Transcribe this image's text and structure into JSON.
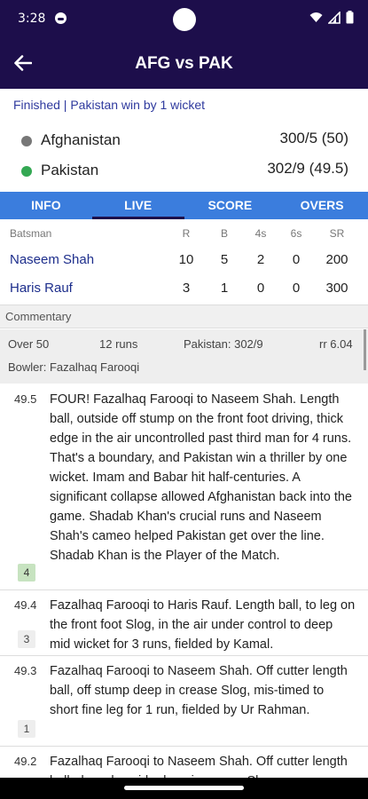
{
  "status": {
    "time": "3:28"
  },
  "header": {
    "title": "AFG vs PAK"
  },
  "result": "Finished | Pakistan win by 1 wicket",
  "teams": [
    {
      "name": "Afghanistan",
      "score": "300/5 (50)",
      "dot_color": "#777777"
    },
    {
      "name": "Pakistan",
      "score": "302/9 (49.5)",
      "dot_color": "#34a853"
    }
  ],
  "tabs": [
    {
      "label": "INFO"
    },
    {
      "label": "LIVE"
    },
    {
      "label": "SCORE"
    },
    {
      "label": "OVERS"
    }
  ],
  "batting": {
    "headers": [
      "Batsman",
      "R",
      "B",
      "4s",
      "6s",
      "SR"
    ],
    "rows": [
      {
        "name": "Naseem Shah",
        "r": "10",
        "b": "5",
        "fours": "2",
        "sixes": "0",
        "sr": "200"
      },
      {
        "name": "Haris Rauf",
        "r": "3",
        "b": "1",
        "fours": "0",
        "sixes": "0",
        "sr": "300"
      }
    ]
  },
  "commentary": {
    "label": "Commentary",
    "over": "Over 50",
    "runs": "12 runs",
    "team_score": "Pakistan: 302/9",
    "run_rate": "rr 6.04",
    "bowler": "Bowler: Fazalhaq Farooqi",
    "balls": [
      {
        "over": "49.5",
        "runs": "4",
        "text": "FOUR! Fazalhaq Farooqi to Naseem Shah. Length ball, outside off stump on the front foot driving, thick edge in the air uncontrolled past third man for 4 runs. That's a boundary, and Pakistan win a thriller by one wicket. Imam and Babar hit half-centuries. A significant collapse allowed Afghanistan back into the game. Shadab Khan's crucial runs and Naseem Shah's cameo helped Pakistan get over the line. Shadab Khan is the Player of the Match."
      },
      {
        "over": "49.4",
        "runs": "3",
        "text": "Fazalhaq Farooqi to Haris Rauf. Length ball, to leg on the front foot Slog, in the air under control to deep mid wicket for 3 runs, fielded by Kamal."
      },
      {
        "over": "49.3",
        "runs": "1",
        "text": "Fazalhaq Farooqi to Naseem Shah. Off cutter length ball, off stump deep in crease Slog, mis-timed to short fine leg for 1 run, fielded by Ur Rahman."
      },
      {
        "over": "49.2",
        "runs": "",
        "text": "Fazalhaq Farooqi to Naseem Shah. Off cutter length ball, down leg side deep in crease Slog"
      }
    ]
  }
}
